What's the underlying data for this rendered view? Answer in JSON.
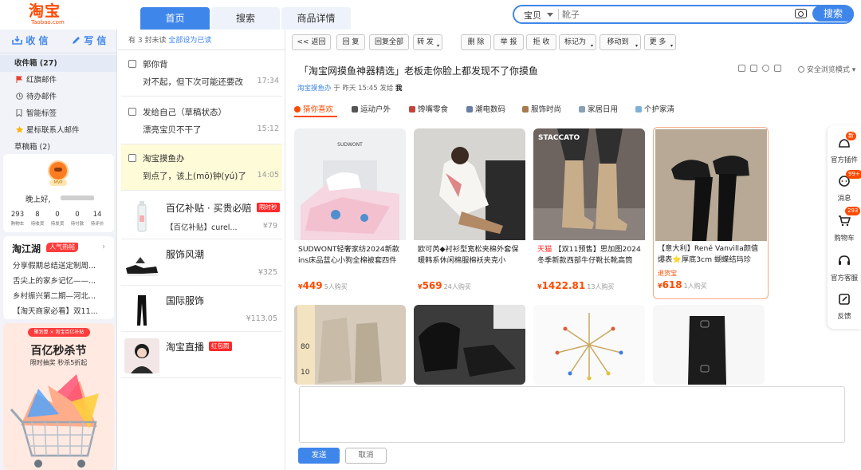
{
  "header": {
    "logo": "淘宝",
    "logo_sub": "Taobao.com",
    "tabs": [
      "首页",
      "搜索",
      "商品详情"
    ],
    "search": {
      "scope": "宝贝",
      "placeholder": "靴子",
      "button": "搜索"
    }
  },
  "left": {
    "receive_btn": "收 信",
    "write_btn": "写 信",
    "folders": [
      "收件箱 (27)",
      "红旗邮件",
      "待办邮件",
      "智能标签",
      "星标联系人邮件",
      "草稿箱 (2)"
    ],
    "user": {
      "mvp": "MVP",
      "greeting": "晚上好,",
      "stats": [
        {
          "num": "293",
          "label": "购物车"
        },
        {
          "num": "8",
          "label": "待收货"
        },
        {
          "num": "0",
          "label": "待发货"
        },
        {
          "num": "0",
          "label": "待付款"
        },
        {
          "num": "14",
          "label": "待评价"
        }
      ]
    },
    "hot": {
      "title": "淘江湖",
      "badge": "人气热帖",
      "items": [
        "分享假期总结送定制周...",
        "舌尖上的家乡记忆——...",
        "乡村振兴第二期—河北...",
        "【淘天商家必看】双11..."
      ]
    },
    "promo": {
      "tag": "聚划算 × 淘宝百亿补贴",
      "title": "百亿秒杀节",
      "sub": "限时抽奖 秒杀5折起"
    }
  },
  "list": {
    "top": "有 3 封未读",
    "mark_all": "全部设为已读",
    "mails": [
      {
        "from": "郭你背",
        "subject": "对不起，但下次可能还要改",
        "time": "17:34"
      },
      {
        "from": "发给自己（草稿状态）",
        "subject": "漂亮宝贝不干了",
        "time": "15:12"
      },
      {
        "from": "淘宝摸鱼办",
        "subject": "到点了，该上(mō)钟(yú)了",
        "time": "14:05"
      }
    ],
    "shop": [
      {
        "title": "百亿补贴 · 买贵必赔",
        "tag": "限时秒",
        "desc": "【百亿补贴】curel...",
        "price": "¥79"
      },
      {
        "title": "服饰风潮",
        "tag": "",
        "desc": "",
        "price": "¥325"
      },
      {
        "title": "国际服饰",
        "tag": "",
        "desc": "",
        "price": "¥113.05"
      },
      {
        "title": "淘宝直播",
        "tag": "红包雨",
        "desc": "",
        "price": ""
      }
    ]
  },
  "reader": {
    "toolbar": [
      "<< 返回",
      "回 复",
      "回复全部",
      "转 发",
      "删 除",
      "举 报",
      "拒 收",
      "标记为",
      "移动到",
      "更 多"
    ],
    "subject": "「淘宝网摸鱼神器精选」老板走你脸上都发现不了你摸鱼",
    "meta": {
      "sender": "淘宝摸鱼办",
      "middle": "于 昨天 15:45 发给",
      "to": "我"
    },
    "safe_mode": "安全浏览模式",
    "categories": [
      "猜你喜欢",
      "运动户外",
      "馋嘴零食",
      "潮电数码",
      "服饰时尚",
      "家居日用",
      "个护家清"
    ],
    "products": [
      {
        "name": "SUDWONT轻奢家纺2024新款ins床品蓝心小狗全棉被套四件",
        "price": "449",
        "buyers": "5人购买",
        "prefix": "",
        "badge": "",
        "img_text": "SUDWONT"
      },
      {
        "name": "欧可芮◆衬衫型宽松夹棉外套保暖韩系休闲棉服棉袄夹克小",
        "price": "569",
        "buyers": "24人购买",
        "prefix": "",
        "badge": "",
        "img_text": ""
      },
      {
        "name": "【双11预售】思加图2024冬季新款西部牛仔靴长靴高筒",
        "price": "1422.81",
        "buyers": "13人购买",
        "prefix": "天猫",
        "badge": "",
        "img_text": "STACCATO"
      },
      {
        "name": "【意大利】René Vanvilla颜值爆表⭐厚底3cm 蝴蝶结玛珍",
        "price": "618",
        "buyers": "1人购买",
        "prefix": "",
        "badge": "退货宝",
        "img_text": ""
      }
    ],
    "row2_texts": [
      "80",
      "10"
    ],
    "send": "发送",
    "cancel": "取消"
  },
  "right_strip": [
    {
      "label": "官方插件",
      "badge": "新"
    },
    {
      "label": "消息",
      "badge": "99+"
    },
    {
      "label": "购物车",
      "badge": "293"
    },
    {
      "label": "官方客服",
      "badge": ""
    },
    {
      "label": "反馈",
      "badge": ""
    }
  ]
}
